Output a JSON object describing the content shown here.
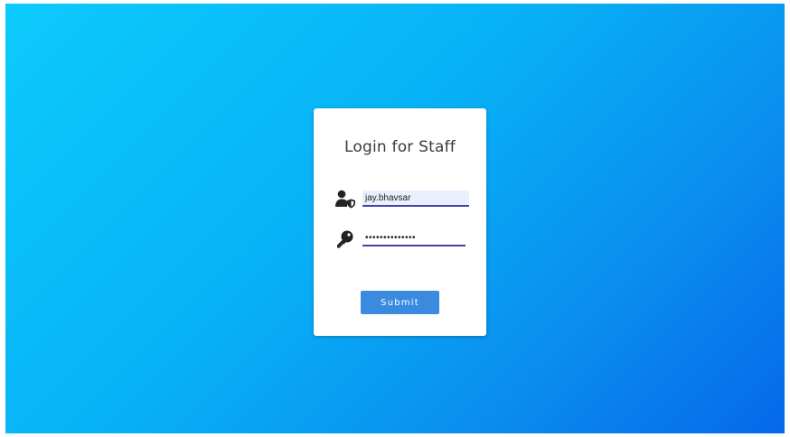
{
  "login": {
    "title": "Login for Staff",
    "username_value": "jay.bhavsar",
    "password_value": "••••••••••••••",
    "submit_label": "Submit"
  },
  "icons": {
    "user": "user-shield-icon",
    "password": "key-icon"
  },
  "colors": {
    "background_start": "#0ccbfd",
    "background_end": "#0668e9",
    "button": "#3a8be0",
    "input_underline": "#4a3fa8",
    "autofill_bg": "#e8f0fe"
  }
}
